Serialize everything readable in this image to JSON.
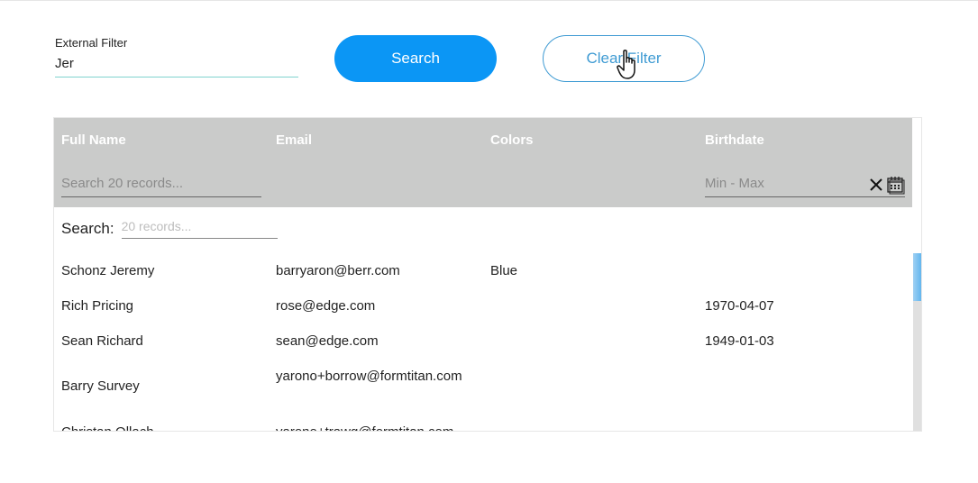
{
  "external_filter": {
    "label": "External Filter",
    "value": "Jer"
  },
  "buttons": {
    "search": "Search",
    "clear_filter": "Clear Filter"
  },
  "colors": {
    "primary": "#0b96f5",
    "outline": "#3f9bd3",
    "header_bg": "#cacbca",
    "scroll_thumb": "#5cb3ee"
  },
  "table": {
    "columns": [
      {
        "label": "Full Name"
      },
      {
        "label": "Email"
      },
      {
        "label": "Colors"
      },
      {
        "label": "Birthdate"
      }
    ],
    "filters": {
      "name_placeholder": "Search 20 records...",
      "birthdate_placeholder": "Min - Max"
    },
    "global_search": {
      "label": "Search:",
      "placeholder": "20 records..."
    },
    "rows": [
      {
        "name": "Schonz Jeremy",
        "email": "barryaron@berr.com",
        "colors": "Blue",
        "birthdate": ""
      },
      {
        "name": "Rich Pricing",
        "email": "rose@edge.com",
        "colors": "",
        "birthdate": "1970-04-07"
      },
      {
        "name": "Sean Richard",
        "email": "sean@edge.com",
        "colors": "",
        "birthdate": "1949-01-03"
      },
      {
        "name": "Barry Survey",
        "email": "yarono+borrow@formtitan.com",
        "colors": "",
        "birthdate": ""
      },
      {
        "name": "Christan Ollach",
        "email": "yarono+trawg@formtitan.com",
        "colors": "",
        "birthdate": ""
      }
    ]
  }
}
